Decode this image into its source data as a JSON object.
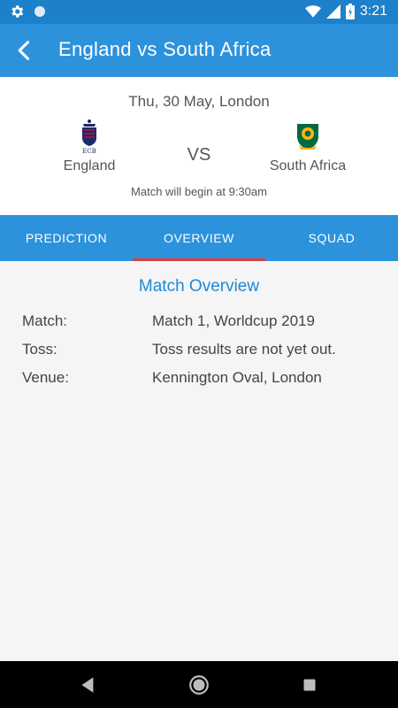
{
  "status_bar": {
    "time": "3:21",
    "icons": [
      "gear-icon",
      "circle-icon",
      "wifi-icon",
      "signal-icon",
      "battery-charging-icon"
    ]
  },
  "app_bar": {
    "title": "England vs South Africa",
    "back_icon": "chevron-left-icon"
  },
  "match": {
    "date": "Thu, 30 May, London",
    "team_home": {
      "name": "England",
      "logo": "ecb-logo"
    },
    "team_away": {
      "name": "South Africa",
      "logo": "proteas-logo"
    },
    "vs_label": "VS",
    "start_text": "Match will begin at 9:30am"
  },
  "tabs": [
    {
      "label": "PREDICTION",
      "active": false
    },
    {
      "label": "OVERVIEW",
      "active": true
    },
    {
      "label": "SQUAD",
      "active": false
    }
  ],
  "overview": {
    "title": "Match Overview",
    "rows": [
      {
        "label": "Match:",
        "value": "Match 1, Worldcup 2019"
      },
      {
        "label": "Toss:",
        "value": "Toss results are not yet out."
      },
      {
        "label": "Venue:",
        "value": "Kennington Oval, London"
      }
    ]
  },
  "colors": {
    "status_bar": "#1c80ca",
    "primary": "#2d92dc",
    "tab_indicator": "#e53935",
    "section_title": "#1e88d7"
  }
}
